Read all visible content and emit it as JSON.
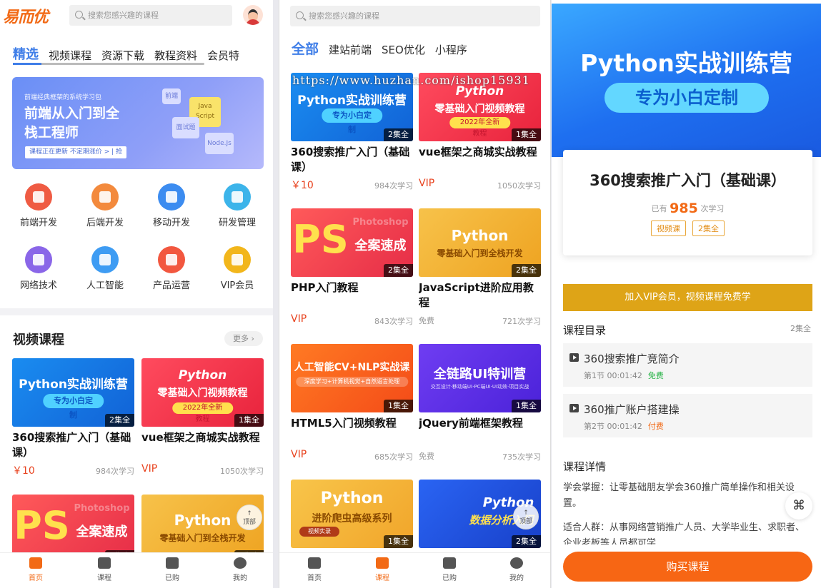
{
  "home": {
    "logo": "易而优",
    "search_placeholder": "搜索您感兴趣的课程",
    "tabs": [
      "精选",
      "视频课程",
      "资源下载",
      "教程资料",
      "会员特"
    ],
    "banner": {
      "small": "前端经典框架的系统学习包",
      "title": "前端从入门到全栈工程师",
      "bar": "课程正在更新 不定期涨价 > | 抢",
      "cube_labels": [
        "前端",
        "Java Script",
        "面试题",
        "Node.Js"
      ]
    },
    "categories": [
      {
        "label": "前端开发",
        "color": "#ef5b43"
      },
      {
        "label": "后端开发",
        "color": "#f38a3d"
      },
      {
        "label": "移动开发",
        "color": "#3c8cf0"
      },
      {
        "label": "研发管理",
        "color": "#3cb4ea"
      },
      {
        "label": "网络技术",
        "color": "#8a66e8"
      },
      {
        "label": "人工智能",
        "color": "#3e9cf3"
      },
      {
        "label": "产品运营",
        "color": "#f2573f"
      },
      {
        "label": "VIP会员",
        "color": "#f2b61b"
      }
    ],
    "section_title": "视频课程",
    "more": "更多 ›",
    "to_top": [
      "↑",
      "顶部"
    ]
  },
  "courses": {
    "python": {
      "thumb": "Python实战训练营",
      "pill": "专为小白定制",
      "tag": "2集全",
      "title": "360搜索推广入门（基础课）",
      "price": "￥10",
      "learn": "984次学习"
    },
    "vue": {
      "thumb": "Python",
      "thumb2": "零基础入门视频教程",
      "pill": "2022年全新教程",
      "tag": "1集全",
      "title": "vue框架之商城实战教程",
      "price": "VIP",
      "learn": "1050次学习"
    },
    "ps": {
      "thumb": "PS",
      "thumb2": "全案速成",
      "sub": "Photoshop",
      "tag": "2集全",
      "title": "PHP入门教程",
      "price": "VIP",
      "learn": "843次学习"
    },
    "pyy": {
      "thumb": "Python",
      "thumb2": "零基础入门到全栈开发",
      "tag": "2集全",
      "title": "JavaScript进阶应用教程",
      "price": "免费",
      "learn": "721次学习"
    },
    "ai": {
      "thumb": "人工智能CV+NLP实战课",
      "pill": "深度学习+计算机视觉+自然语言处理",
      "tag": "1集全",
      "title": "HTML5入门视频教程",
      "price": "VIP",
      "learn": "685次学习"
    },
    "ui": {
      "thumb": "全链路UI特训营",
      "pill": "交互设计·移动端UI·PC端UI·UI动效·项目实战",
      "tag": "1集全",
      "title": "jQuery前端框架教程",
      "price": "免费",
      "learn": "735次学习"
    },
    "spider": {
      "thumb": "Python",
      "thumb2": "进阶爬虫高级系列",
      "pill": "视频实录",
      "tag": "1集全"
    },
    "data": {
      "thumb": "Python",
      "thumb2": "数据分析入门",
      "tag": "2集全"
    }
  },
  "list": {
    "search_placeholder": "搜索您感兴趣的课程",
    "tabs": [
      "全部",
      "建站前端",
      "SEO优化",
      "小程序"
    ],
    "watermark": "https://www.huzhan.com/ishop15931",
    "to_top": [
      "↑",
      "顶部"
    ]
  },
  "detail": {
    "hero_title": "Python实战训练营",
    "hero_sub": "专为小白定制",
    "title": "360搜索推广入门（基础课）",
    "stat_prefix": "已有",
    "stat_num": "985",
    "stat_suffix": "次学习",
    "badges": [
      "视频课",
      "2集全"
    ],
    "vip": "加入VIP会员，视频课程免费学",
    "catalog_title": "课程目录",
    "catalog_count": "2集全",
    "lessons": [
      {
        "title": "360搜索推广竞简介",
        "meta": "第1节  00:01:42",
        "status": "免费"
      },
      {
        "title": "360推广账户搭建操",
        "meta": "第2节  00:01:42",
        "status": "付费"
      }
    ],
    "detail_title": "课程详情",
    "detail_lines": [
      "学会掌握：让零基础朋友学会360推广简单操作和相关设置。",
      "适合人群：从事网络营销推广人员、大学毕业生、求职者、企业老板等人员都可学"
    ],
    "buy": "购买课程",
    "float_icon": "⌘"
  },
  "nav": {
    "items": [
      "首页",
      "课程",
      "已购",
      "我的"
    ]
  },
  "colors": {
    "accent": "#3f7ee8",
    "orange": "#f26a16",
    "red": "#e8421e",
    "gold": "#dea417"
  }
}
